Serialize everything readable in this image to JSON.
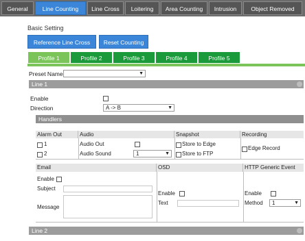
{
  "top_tabs": [
    "General",
    "Line Counting",
    "Line Cross",
    "Loitering",
    "Area Counting",
    "Intrusion",
    "Object Removed"
  ],
  "basic_setting": "Basic Setting",
  "buttons": {
    "reference_line_cross": "Reference Line Cross",
    "reset_counting": "Reset Counting"
  },
  "profiles": [
    "Profile 1",
    "Profile 2",
    "Profile 3",
    "Profile 4",
    "Profile 5"
  ],
  "preset_name_label": "Preset Name",
  "preset_name_value": "",
  "line1": {
    "title": "Line 1",
    "enable_label": "Enable",
    "direction_label": "Direction",
    "direction_value": "A -> B"
  },
  "handlers": {
    "title": "Handlers",
    "headers": [
      "Alarm Out",
      "Audio",
      "Snapshot",
      "Recording"
    ],
    "alarm_out": [
      "1",
      "2"
    ],
    "audio_out_label": "Audio Out",
    "audio_sound_label": "Audio Sound",
    "audio_sound_value": "1",
    "snapshot": [
      "Store to Edge",
      "Store to FTP"
    ],
    "recording": "Edge Record"
  },
  "email": {
    "title": "Email",
    "enable": "Enable",
    "subject": "Subject",
    "message": "Message"
  },
  "osd": {
    "title": "OSD",
    "enable": "Enable",
    "text": "Text"
  },
  "http": {
    "title": "HTTP Generic Event",
    "enable": "Enable",
    "method": "Method",
    "method_value": "1"
  },
  "line2": {
    "title": "Line 2"
  },
  "colors": {
    "tab_active": "#3b86d8",
    "profile_green": "#1a9a3a",
    "profile_active": "#7ac45a",
    "section_gray": "#9c9c9c"
  }
}
